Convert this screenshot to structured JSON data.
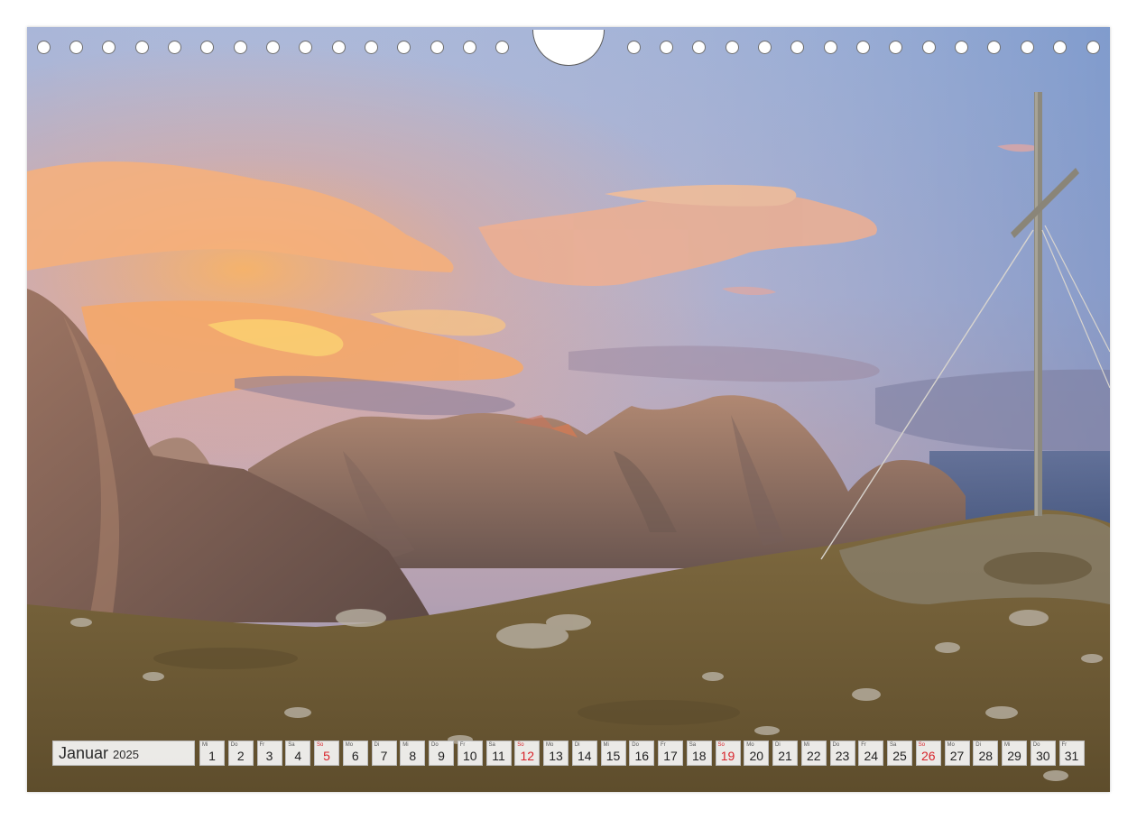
{
  "calendar": {
    "month": "Januar",
    "year": "2025",
    "sunday_color": "#d8232a",
    "days": [
      {
        "wd": "Mi",
        "num": "1",
        "sunday": false
      },
      {
        "wd": "Do",
        "num": "2",
        "sunday": false
      },
      {
        "wd": "Fr",
        "num": "3",
        "sunday": false
      },
      {
        "wd": "Sa",
        "num": "4",
        "sunday": false
      },
      {
        "wd": "So",
        "num": "5",
        "sunday": true
      },
      {
        "wd": "Mo",
        "num": "6",
        "sunday": false
      },
      {
        "wd": "Di",
        "num": "7",
        "sunday": false
      },
      {
        "wd": "Mi",
        "num": "8",
        "sunday": false
      },
      {
        "wd": "Do",
        "num": "9",
        "sunday": false
      },
      {
        "wd": "Fr",
        "num": "10",
        "sunday": false
      },
      {
        "wd": "Sa",
        "num": "11",
        "sunday": false
      },
      {
        "wd": "So",
        "num": "12",
        "sunday": true
      },
      {
        "wd": "Mo",
        "num": "13",
        "sunday": false
      },
      {
        "wd": "Di",
        "num": "14",
        "sunday": false
      },
      {
        "wd": "Mi",
        "num": "15",
        "sunday": false
      },
      {
        "wd": "Do",
        "num": "16",
        "sunday": false
      },
      {
        "wd": "Fr",
        "num": "17",
        "sunday": false
      },
      {
        "wd": "Sa",
        "num": "18",
        "sunday": false
      },
      {
        "wd": "So",
        "num": "19",
        "sunday": true
      },
      {
        "wd": "Mo",
        "num": "20",
        "sunday": false
      },
      {
        "wd": "Di",
        "num": "21",
        "sunday": false
      },
      {
        "wd": "Mi",
        "num": "22",
        "sunday": false
      },
      {
        "wd": "Do",
        "num": "23",
        "sunday": false
      },
      {
        "wd": "Fr",
        "num": "24",
        "sunday": false
      },
      {
        "wd": "Sa",
        "num": "25",
        "sunday": false
      },
      {
        "wd": "So",
        "num": "26",
        "sunday": true
      },
      {
        "wd": "Mo",
        "num": "27",
        "sunday": false
      },
      {
        "wd": "Di",
        "num": "28",
        "sunday": false
      },
      {
        "wd": "Mi",
        "num": "29",
        "sunday": false
      },
      {
        "wd": "Do",
        "num": "30",
        "sunday": false
      },
      {
        "wd": "Fr",
        "num": "31",
        "sunday": false
      }
    ]
  },
  "photo": {
    "subject": "mountain-summit-cross-at-sunrise",
    "sky_top_color": "#8aa6cf",
    "cloud_glow_color": "#f3a35f",
    "rock_color": "#9a7a68",
    "meadow_color": "#6e5a32"
  }
}
